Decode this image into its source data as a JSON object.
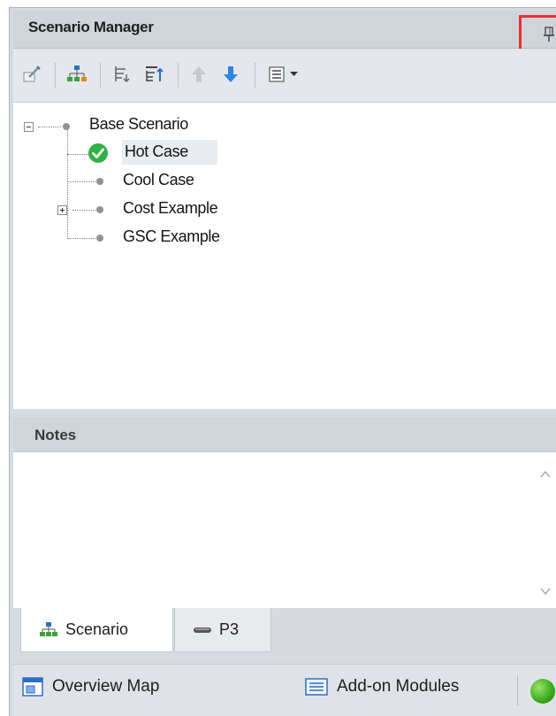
{
  "panel": {
    "title": "Scenario Manager",
    "pin_icon": "pin-icon",
    "highlight_color": "#e8322d"
  },
  "toolbar": {
    "buttons": [
      {
        "name": "edit-scenario-button",
        "icon": "edit-icon"
      },
      {
        "name": "create-child-button",
        "icon": "tree-add-icon"
      },
      {
        "name": "expand-button",
        "icon": "expand-tree-icon"
      },
      {
        "name": "collapse-button",
        "icon": "collapse-tree-icon"
      },
      {
        "name": "move-up-button",
        "icon": "arrow-up-icon"
      },
      {
        "name": "move-down-button",
        "icon": "arrow-down-icon"
      },
      {
        "name": "view-options-dropdown",
        "icon": "list-view-icon"
      }
    ]
  },
  "tree": {
    "root": "Base Scenario",
    "children": [
      "Hot Case",
      "Cool Case",
      "Cost Example",
      "GSC Example"
    ],
    "active_item": "Hot Case",
    "active_color": "#2fb344"
  },
  "notes": {
    "title": "Notes",
    "content": ""
  },
  "tabs": [
    {
      "label": "Scenario",
      "icon": "scenario-tree-icon",
      "active": true
    },
    {
      "label": "P3",
      "icon": "pipe-icon",
      "active": false
    }
  ],
  "statusbar": {
    "overview_map": "Overview Map",
    "addon_modules": "Add-on Modules",
    "status_color": "#3fae1d"
  }
}
